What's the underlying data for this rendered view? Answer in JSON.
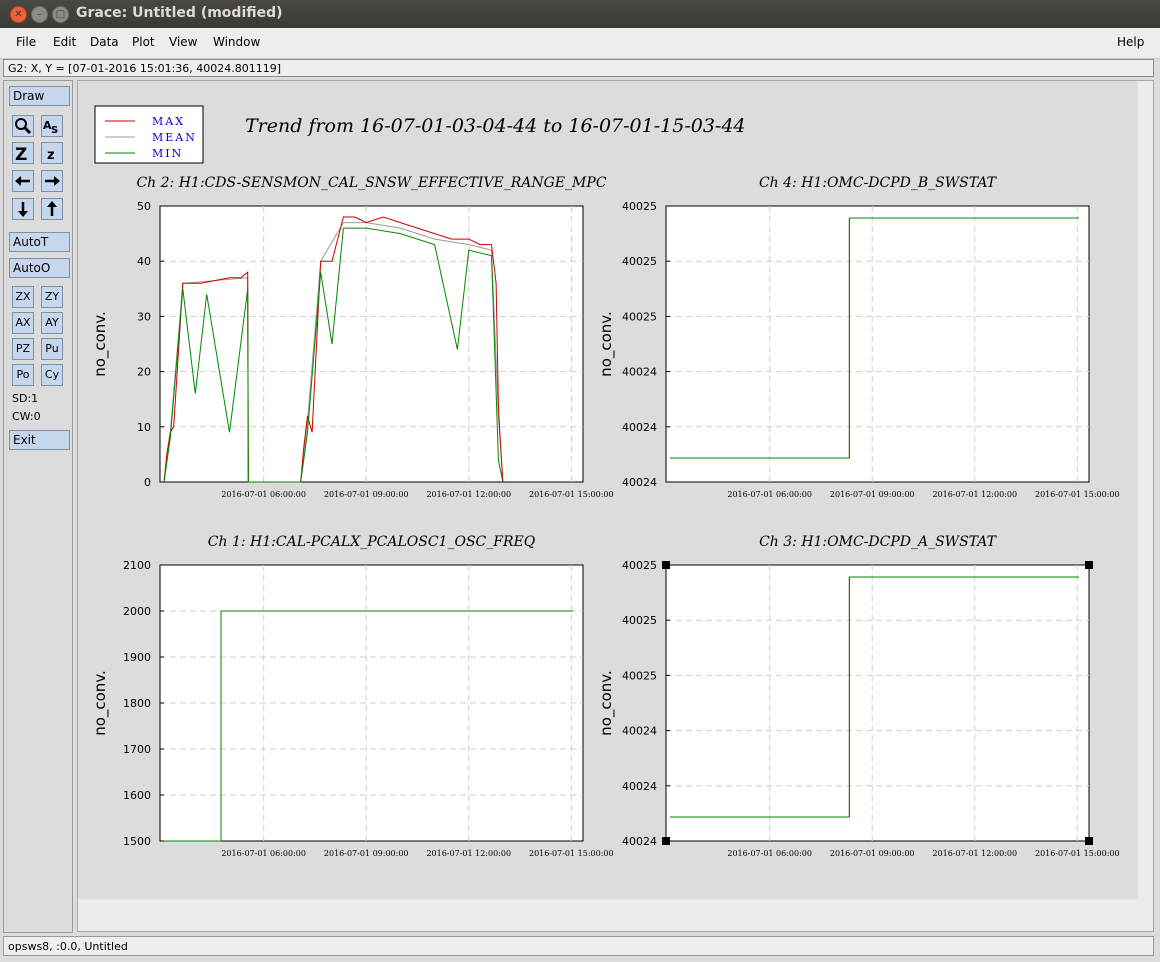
{
  "window": {
    "title": "Grace: Untitled (modified)"
  },
  "menubar": {
    "file": "File",
    "edit": "Edit",
    "data": "Data",
    "plot": "Plot",
    "view": "View",
    "window": "Window",
    "help": "Help"
  },
  "locator": {
    "text": "G2: X, Y = [07-01-2016 15:01:36, 40024.801119]"
  },
  "toolbar": {
    "draw": "Draw",
    "autot": "AutoT",
    "autoo": "AutoO",
    "zx": "ZX",
    "zy": "ZY",
    "ax": "AX",
    "ay": "AY",
    "pz": "PZ",
    "pu": "Pu",
    "po": "Po",
    "cy": "Cy",
    "sd": "SD:1",
    "cw": "CW:0",
    "exit": "Exit"
  },
  "status": {
    "text": "opsws8, :0.0, Untitled"
  },
  "colors": {
    "max": "#cc0000",
    "mean": "#999999",
    "min": "#008800",
    "legend_text": "#0000cc"
  },
  "canvas": {
    "title": "Trend from 16-07-01-03-04-44 to 16-07-01-15-03-44",
    "legend": [
      "MAX",
      "MEAN",
      "MIN"
    ]
  },
  "chart_data": [
    {
      "type": "line",
      "title": "Ch 2: H1:CDS-SENSMON_CAL_SNSW_EFFECTIVE_RANGE_MPC",
      "ylabel": "no_conv.",
      "xlabel": "",
      "yticks": [
        "50",
        "40",
        "30",
        "20",
        "10",
        "0"
      ],
      "xticks": [
        "2016-07-01 06:00:00",
        "2016-07-01 09:00:00",
        "2016-07-01 12:00:00",
        "2016-07-01 15:00:00"
      ],
      "ylim": [
        0,
        50
      ],
      "grid": true,
      "legend": "top-left",
      "series": [
        {
          "name": "MAX",
          "x": [
            "03:05",
            "03:10",
            "03:16",
            "03:22",
            "03:38",
            "04:10",
            "05:00",
            "05:20",
            "05:32",
            "05:33",
            "05:38",
            "06:30",
            "07:05",
            "07:10",
            "07:17",
            "07:25",
            "07:40",
            "08:00",
            "08:20",
            "08:40",
            "09:00",
            "09:30",
            "10:00",
            "10:30",
            "11:00",
            "11:30",
            "12:00",
            "12:20",
            "12:40",
            "12:48",
            "12:52",
            "12:55",
            "13:00"
          ],
          "y": [
            0,
            5,
            9,
            10,
            36,
            36,
            37,
            37,
            38,
            0,
            0,
            0,
            0,
            6,
            12,
            9,
            40,
            40,
            48,
            48,
            47,
            48,
            47,
            46,
            45,
            44,
            44,
            43,
            43,
            36,
            14,
            8,
            0
          ]
        },
        {
          "name": "MEAN",
          "x": [
            "03:05",
            "03:16",
            "03:38",
            "05:32",
            "05:33",
            "07:05",
            "07:17",
            "07:40",
            "08:20",
            "09:00",
            "10:00",
            "11:00",
            "12:00",
            "12:40",
            "12:52",
            "13:00"
          ],
          "y": [
            0,
            9,
            36,
            37,
            0,
            0,
            11,
            40,
            47,
            47,
            46,
            44,
            43,
            42,
            12,
            0
          ]
        },
        {
          "name": "MIN",
          "x": [
            "03:05",
            "03:16",
            "03:38",
            "04:00",
            "04:20",
            "05:00",
            "05:32",
            "05:33",
            "07:05",
            "07:17",
            "07:40",
            "08:00",
            "08:20",
            "09:00",
            "10:00",
            "11:00",
            "11:40",
            "12:00",
            "12:40",
            "12:52",
            "13:00"
          ],
          "y": [
            0,
            8,
            35,
            16,
            34,
            9,
            35,
            0,
            0,
            9,
            38,
            25,
            46,
            46,
            45,
            43,
            24,
            42,
            41,
            4,
            0
          ]
        }
      ]
    },
    {
      "type": "line",
      "title": "Ch 4: H1:OMC-DCPD_B_SWSTAT",
      "ylabel": "no_conv.",
      "xlabel": "",
      "yticks": [
        "40025",
        "40025",
        "40025",
        "40024",
        "40024",
        "40024"
      ],
      "xticks": [
        "2016-07-01 06:00:00",
        "2016-07-01 09:00:00",
        "2016-07-01 12:00:00",
        "2016-07-01 15:00:00"
      ],
      "grid": true,
      "series": [
        {
          "name": "MAX",
          "x": [
            "03:05",
            "08:20",
            "08:20",
            "15:03"
          ],
          "y": [
            40024,
            40024,
            40025,
            40025
          ]
        },
        {
          "name": "MEAN",
          "x": [
            "03:05",
            "08:20",
            "08:20",
            "15:03"
          ],
          "y": [
            40024,
            40024,
            40025,
            40025
          ]
        },
        {
          "name": "MIN",
          "x": [
            "03:05",
            "08:20",
            "08:20",
            "15:03"
          ],
          "y": [
            40024,
            40024,
            40025,
            40025
          ]
        }
      ]
    },
    {
      "type": "line",
      "title": "Ch 1: H1:CAL-PCALX_PCALOSC1_OSC_FREQ",
      "ylabel": "no_conv.",
      "xlabel": "",
      "yticks": [
        "2100",
        "2000",
        "1900",
        "1800",
        "1700",
        "1600",
        "1500"
      ],
      "xticks": [
        "2016-07-01 06:00:00",
        "2016-07-01 09:00:00",
        "2016-07-01 12:00:00",
        "2016-07-01 15:00:00"
      ],
      "ylim": [
        1500,
        2100
      ],
      "grid": true,
      "series": [
        {
          "name": "MAX",
          "x": [
            "03:05",
            "04:45",
            "04:45",
            "15:03"
          ],
          "y": [
            1500,
            1500,
            2000,
            2000
          ]
        },
        {
          "name": "MEAN",
          "x": [
            "03:05",
            "04:45",
            "04:45",
            "15:03"
          ],
          "y": [
            1500,
            1500,
            2000,
            2000
          ]
        },
        {
          "name": "MIN",
          "x": [
            "03:05",
            "04:45",
            "04:45",
            "15:03"
          ],
          "y": [
            1500,
            1500,
            2000,
            2000
          ]
        }
      ]
    },
    {
      "type": "line",
      "title": "Ch 3: H1:OMC-DCPD_A_SWSTAT",
      "ylabel": "no_conv.",
      "xlabel": "",
      "yticks": [
        "40025",
        "40025",
        "40025",
        "40024",
        "40024",
        "40024"
      ],
      "xticks": [
        "2016-07-01 06:00:00",
        "2016-07-01 09:00:00",
        "2016-07-01 12:00:00",
        "2016-07-01 15:00:00"
      ],
      "grid": true,
      "series": [
        {
          "name": "MAX",
          "x": [
            "03:05",
            "08:20",
            "08:20",
            "15:03"
          ],
          "y": [
            40024,
            40024,
            40025,
            40025
          ]
        },
        {
          "name": "MEAN",
          "x": [
            "03:05",
            "08:20",
            "08:20",
            "15:03"
          ],
          "y": [
            40024,
            40024,
            40025,
            40025
          ]
        },
        {
          "name": "MIN",
          "x": [
            "03:05",
            "08:20",
            "08:20",
            "15:03"
          ],
          "y": [
            40024,
            40024,
            40025,
            40025
          ]
        }
      ]
    }
  ]
}
